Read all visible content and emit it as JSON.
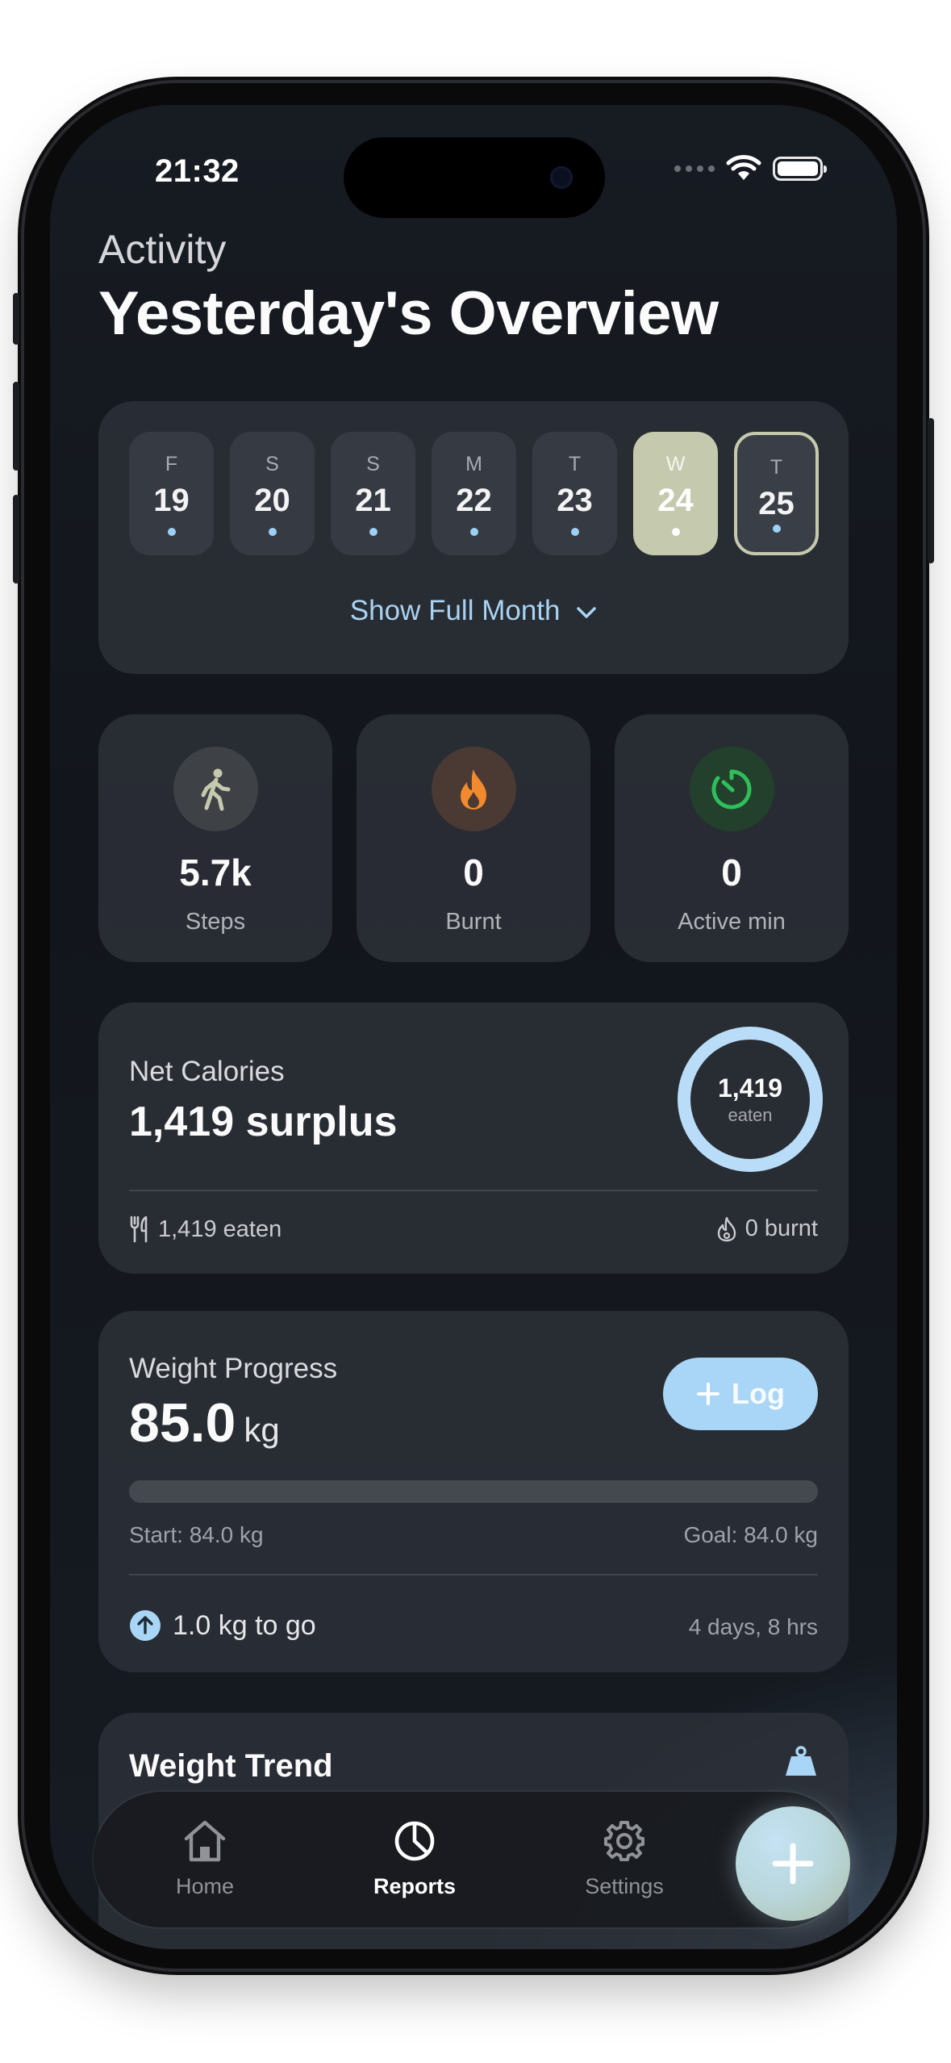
{
  "status": {
    "time": "21:32"
  },
  "header": {
    "subtitle": "Activity",
    "title": "Yesterday's Overview"
  },
  "calendar": {
    "days": [
      {
        "weekday": "F",
        "date": "19"
      },
      {
        "weekday": "S",
        "date": "20"
      },
      {
        "weekday": "S",
        "date": "21"
      },
      {
        "weekday": "M",
        "date": "22"
      },
      {
        "weekday": "T",
        "date": "23"
      },
      {
        "weekday": "W",
        "date": "24",
        "selected": true
      },
      {
        "weekday": "T",
        "date": "25",
        "today": true
      }
    ],
    "show_month_label": "Show Full Month"
  },
  "metrics": [
    {
      "value": "5.7k",
      "label": "Steps",
      "icon": "walking-icon",
      "color": "#c5c9ad"
    },
    {
      "value": "0",
      "label": "Burnt",
      "icon": "flame-icon",
      "color": "#f08a2c"
    },
    {
      "value": "0",
      "label": "Active min",
      "icon": "timer-icon",
      "color": "#2fbf5a"
    }
  ],
  "net_calories": {
    "label": "Net Calories",
    "value": "1,419 surplus",
    "ring_value": "1,419",
    "ring_label": "eaten",
    "ring_fraction": 1.0,
    "eaten_label": "1,419 eaten",
    "burnt_label": "0 burnt"
  },
  "weight_progress": {
    "label": "Weight Progress",
    "value": "85.0",
    "unit": "kg",
    "log_label": "Log",
    "progress_fraction": 0.0,
    "start_label": "Start: 84.0 kg",
    "goal_label": "Goal: 84.0 kg",
    "to_go_label": "1.0 kg to go",
    "time_label": "4 days, 8 hrs"
  },
  "weight_trend": {
    "label": "Weight Trend"
  },
  "tabbar": {
    "items": [
      {
        "label": "Home",
        "icon": "home-icon"
      },
      {
        "label": "Reports",
        "icon": "reports-icon",
        "active": true
      },
      {
        "label": "Settings",
        "icon": "gear-icon"
      }
    ],
    "fab_icon": "plus-icon"
  },
  "colors": {
    "accent_blue": "#a9d6f6",
    "selected_day": "#c5c9ad"
  }
}
